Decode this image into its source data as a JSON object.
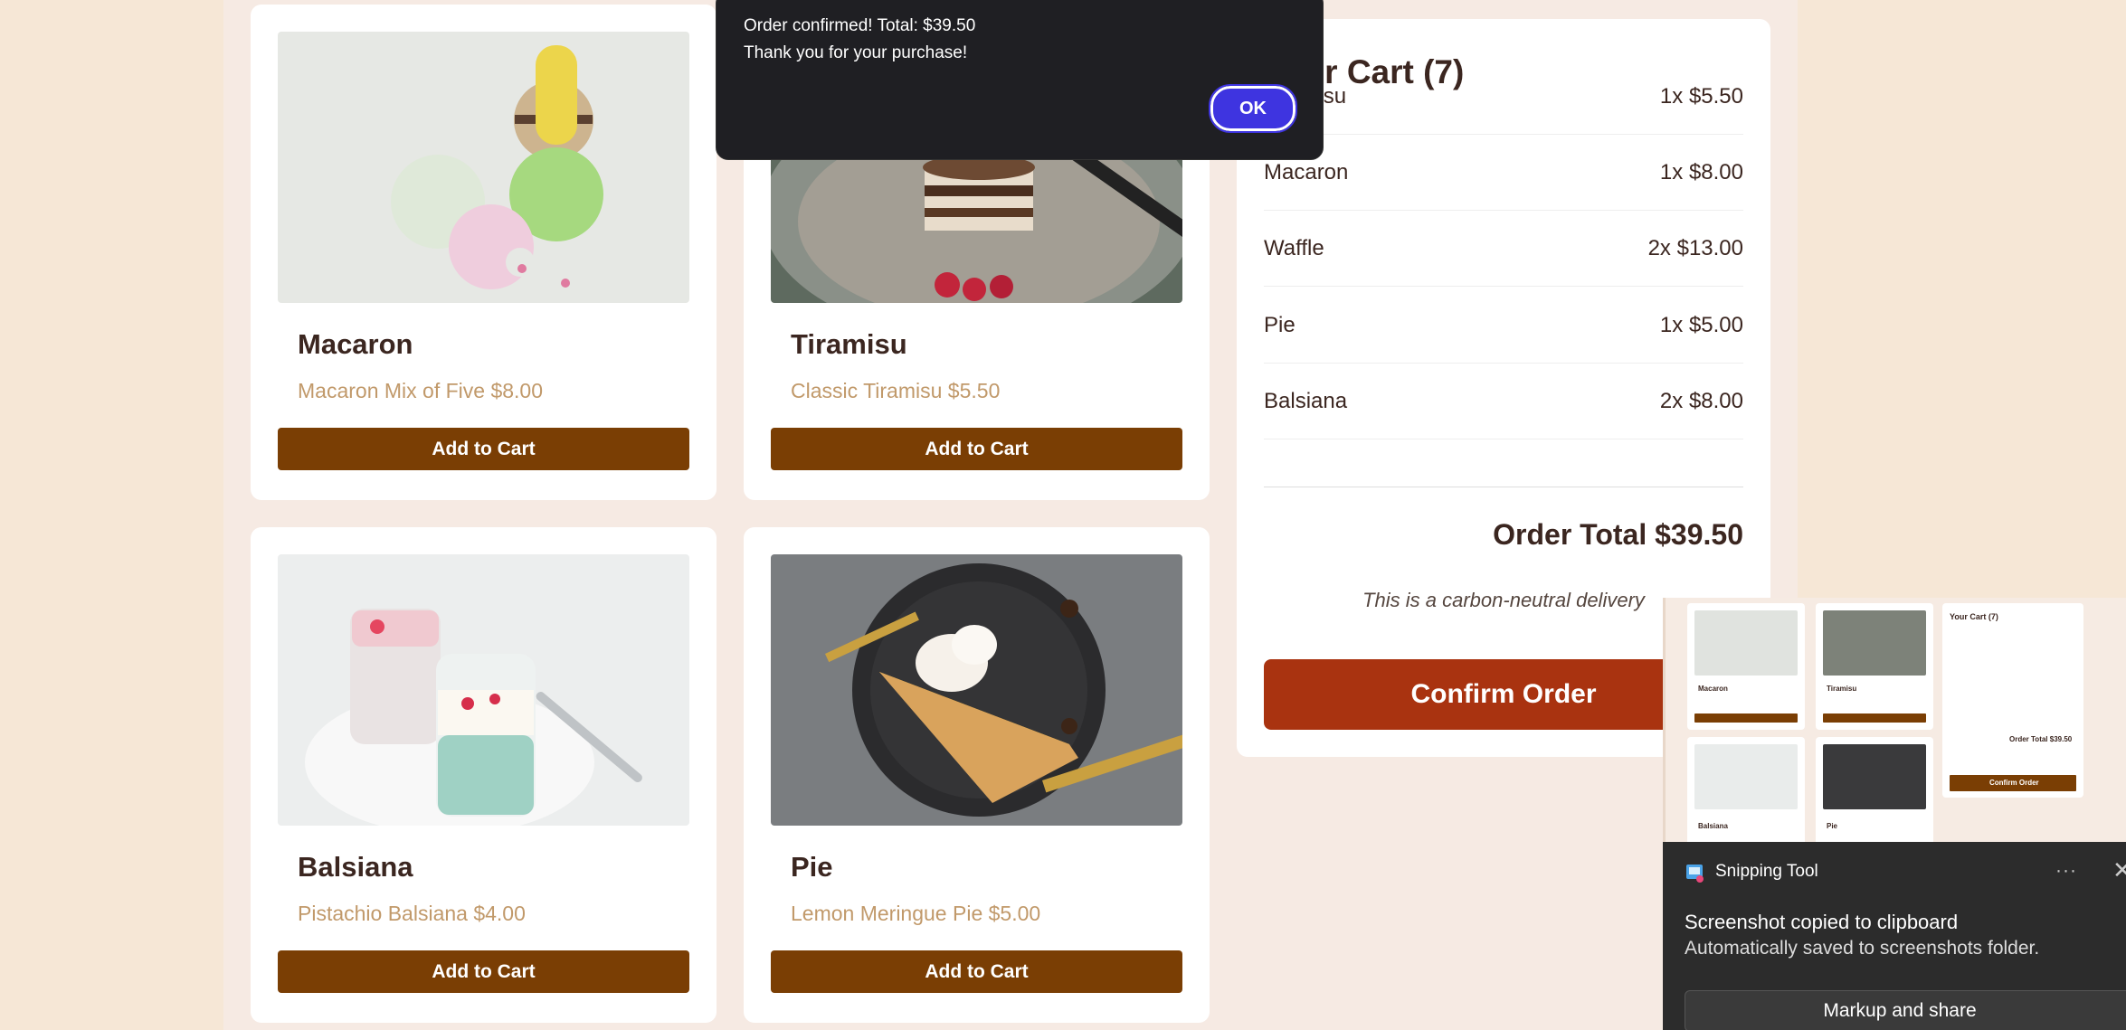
{
  "products": [
    {
      "name": "Macaron",
      "desc": "Macaron Mix of Five $8.00",
      "button": "Add to Cart"
    },
    {
      "name": "Tiramisu",
      "desc": "Classic Tiramisu $5.50",
      "button": "Add to Cart"
    },
    {
      "name": "Balsiana",
      "desc": "Pistachio Balsiana $4.00",
      "button": "Add to Cart"
    },
    {
      "name": "Pie",
      "desc": "Lemon Meringue Pie $5.00",
      "button": "Add to Cart"
    }
  ],
  "cart": {
    "title": "Your Cart (7)",
    "items": [
      {
        "name": "Tiramisu",
        "qty_price": "1x $5.50"
      },
      {
        "name": "Macaron",
        "qty_price": "1x $8.00"
      },
      {
        "name": "Waffle",
        "qty_price": "2x $13.00"
      },
      {
        "name": "Pie",
        "qty_price": "1x $5.00"
      },
      {
        "name": "Balsiana",
        "qty_price": "2x $8.00"
      }
    ],
    "total": "Order Total $39.50",
    "carbon_note": "This is a carbon-neutral delivery",
    "confirm_label": "Confirm Order"
  },
  "dialog": {
    "line1": "Order confirmed! Total: $39.50",
    "line2": "Thank you for your purchase!",
    "ok_label": "OK"
  },
  "notification": {
    "app_name": "Snipping Tool",
    "more": "···",
    "close": "✕",
    "message": "Screenshot copied to clipboard",
    "sub_message": "Automatically saved to screenshots folder.",
    "action": "Markup and share"
  },
  "thumbnail": {
    "cart_title": "Your Cart (7)",
    "total": "Order Total $39.50",
    "confirm": "Confirm Order",
    "names": [
      "Macaron",
      "Tiramisu",
      "Balsiana",
      "Pie"
    ]
  },
  "colors": {
    "button_brown": "#7a3e04",
    "confirm_red": "#a93310",
    "ok_blue": "#3e34e0",
    "desc_gold": "#c1996a"
  },
  "icons": {
    "snipping_tool": "snipping-tool-icon"
  }
}
